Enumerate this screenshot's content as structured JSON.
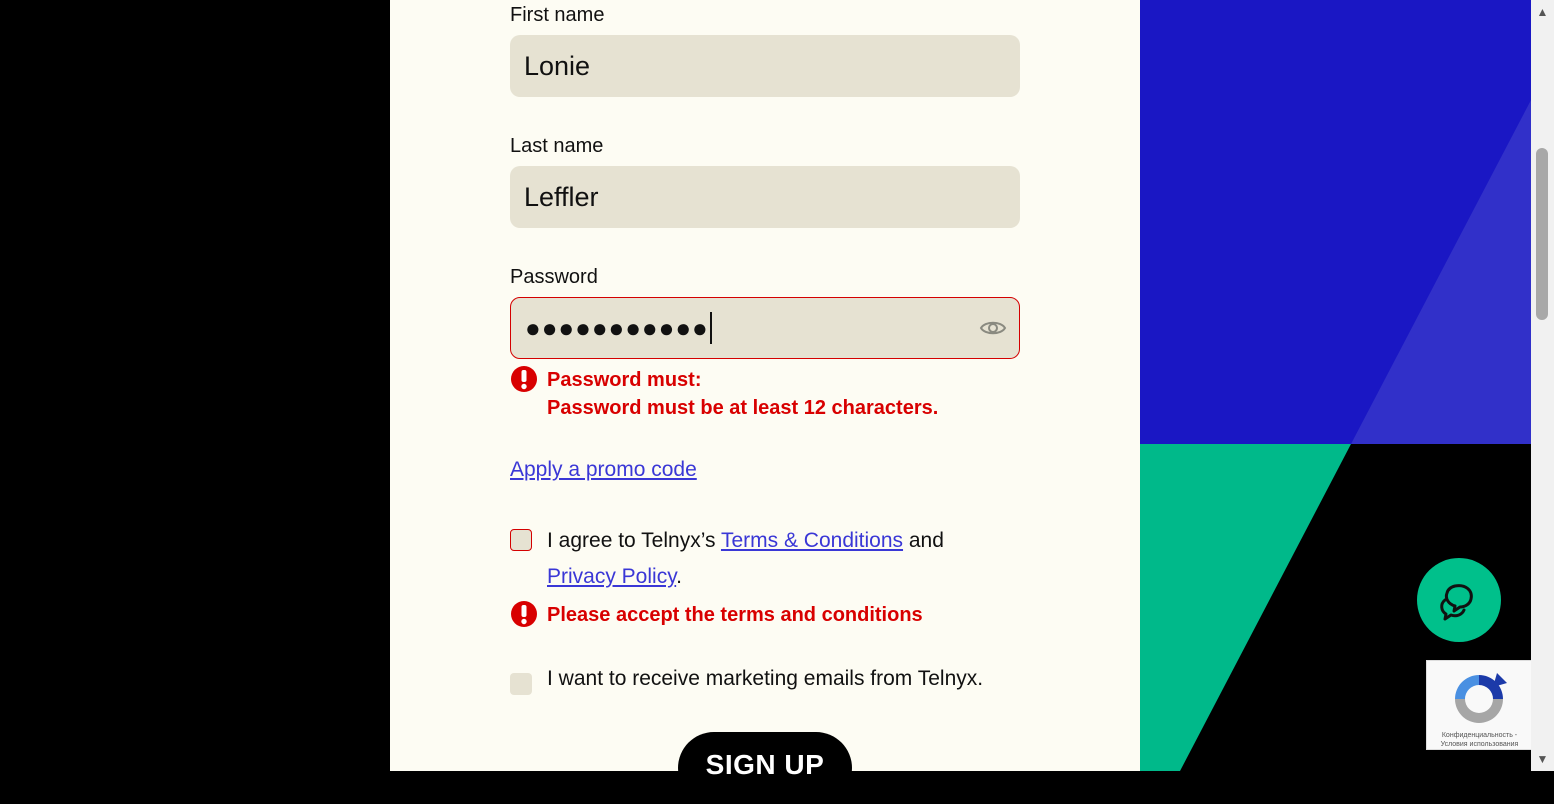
{
  "form": {
    "first_name": {
      "label": "First name",
      "value": "Lonie"
    },
    "last_name": {
      "label": "Last name",
      "value": "Leffler"
    },
    "password": {
      "label": "Password",
      "masked_value": "●●●●●●●●●●●",
      "error_title": "Password must:",
      "error_detail": "Password must be at least 12 characters."
    },
    "promo_link": "Apply a promo code",
    "terms": {
      "prefix": "I agree to Telnyx’s ",
      "terms_link": "Terms & Conditions",
      "middle": " and",
      "privacy_link": "Privacy Policy",
      "suffix": ".",
      "error": "Please accept the terms and conditions"
    },
    "marketing": {
      "label": "I want to receive marketing emails from Telnyx."
    },
    "submit_label": "SIGN UP"
  },
  "recaptcha": {
    "line1": "Конфиденциальность -",
    "line2": "Условия использования"
  },
  "colors": {
    "panel_bg": "#fdfcf3",
    "input_bg": "#e6e2d2",
    "error": "#d80000",
    "link": "#3a37d6",
    "art_blue": "#1a17c4",
    "art_green": "#00b98a",
    "chat_green": "#00c08b"
  }
}
